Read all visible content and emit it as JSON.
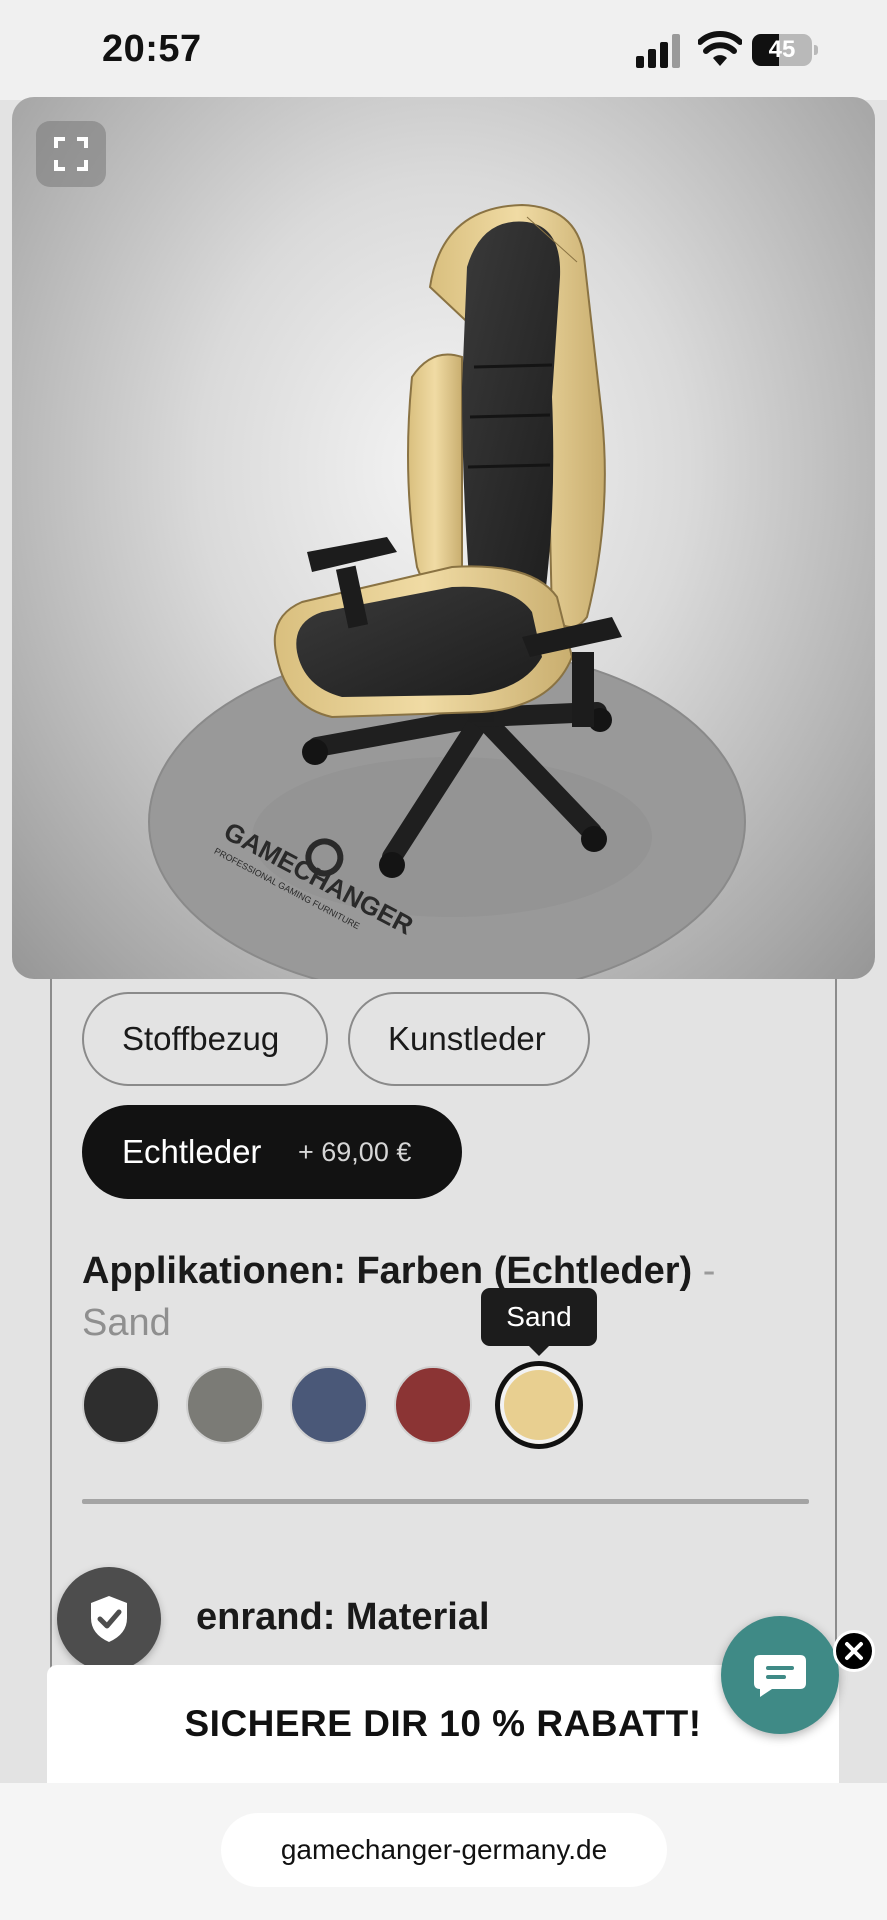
{
  "status_bar": {
    "time": "20:57",
    "battery_percent": "45",
    "battery_level": 0.45
  },
  "viewer": {
    "fullscreen_icon": "fullscreen-icon",
    "logo_text": "GAMECHANGER",
    "logo_tagline": "PROFESSIONAL GAMING FURNITURE"
  },
  "material_options": {
    "stoff_label": "Stoffbezug",
    "kunst_label": "Kunstleder",
    "echt_label": "Echtleder",
    "echt_price": "+ 69,00 €",
    "selected": "Echtleder"
  },
  "applications": {
    "title": "Applikationen: Farben (Echtleder)",
    "separator": "-",
    "selected_value": "Sand",
    "tooltip": "Sand",
    "swatches": [
      {
        "name": "black",
        "color": "#2e2e2e"
      },
      {
        "name": "grey",
        "color": "#7b7b76"
      },
      {
        "name": "blue",
        "color": "#4a5878"
      },
      {
        "name": "red",
        "color": "#8b3434"
      },
      {
        "name": "sand",
        "color": "#e8cf90"
      }
    ]
  },
  "next_section": {
    "title_partial": "enrand: Material"
  },
  "promo": {
    "text": "SICHERE DIR 10 % RABATT!"
  },
  "browser": {
    "url": "gamechanger-germany.de"
  },
  "colors": {
    "accent_teal": "#3f8a86",
    "chair_black": "#2b2b2b",
    "chair_sand": "#e8cf90"
  }
}
